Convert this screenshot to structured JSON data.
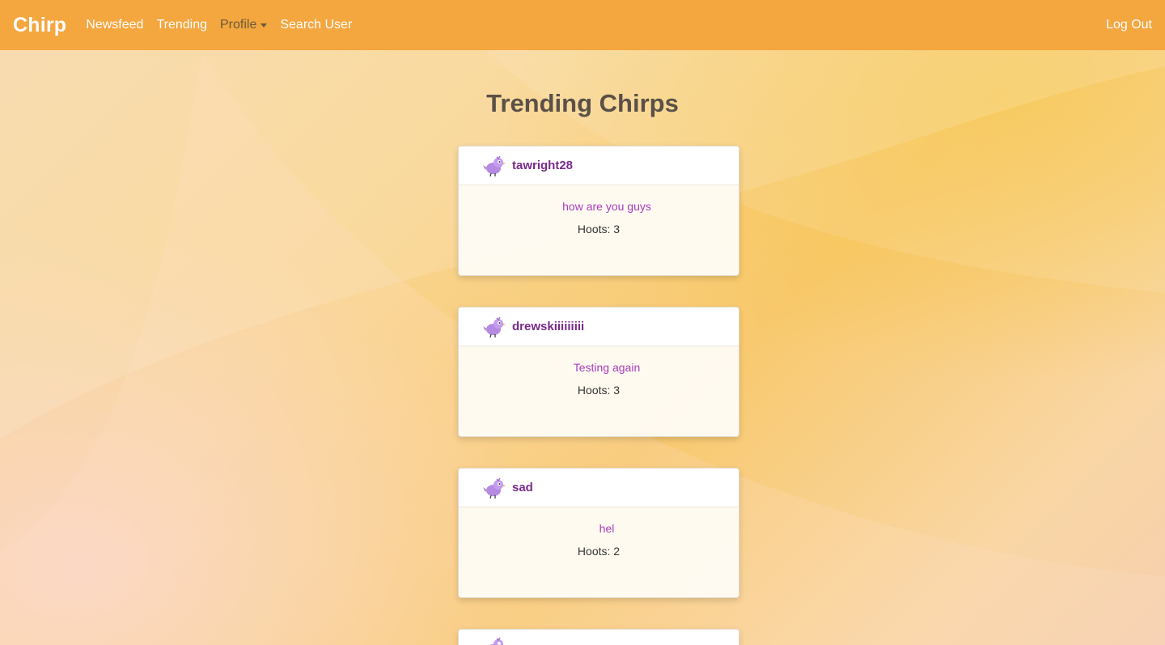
{
  "nav": {
    "brand": "Chirp",
    "links": [
      "Newsfeed",
      "Trending",
      "Profile",
      "Search User"
    ],
    "logout": "Log Out"
  },
  "page": {
    "title": "Trending Chirps"
  },
  "chirps": [
    {
      "username": "tawright28",
      "message": "how are you guys",
      "hoots": "Hoots: 3"
    },
    {
      "username": "drewskiiiiiiiii",
      "message": "Testing again",
      "hoots": "Hoots: 3"
    },
    {
      "username": "sad",
      "message": "hel",
      "hoots": "Hoots: 2"
    }
  ],
  "colors": {
    "navbar": "#f4a63f",
    "username": "#7a2a8c",
    "message": "#a83cc0"
  },
  "icons": {
    "avatar": "bird-icon"
  }
}
